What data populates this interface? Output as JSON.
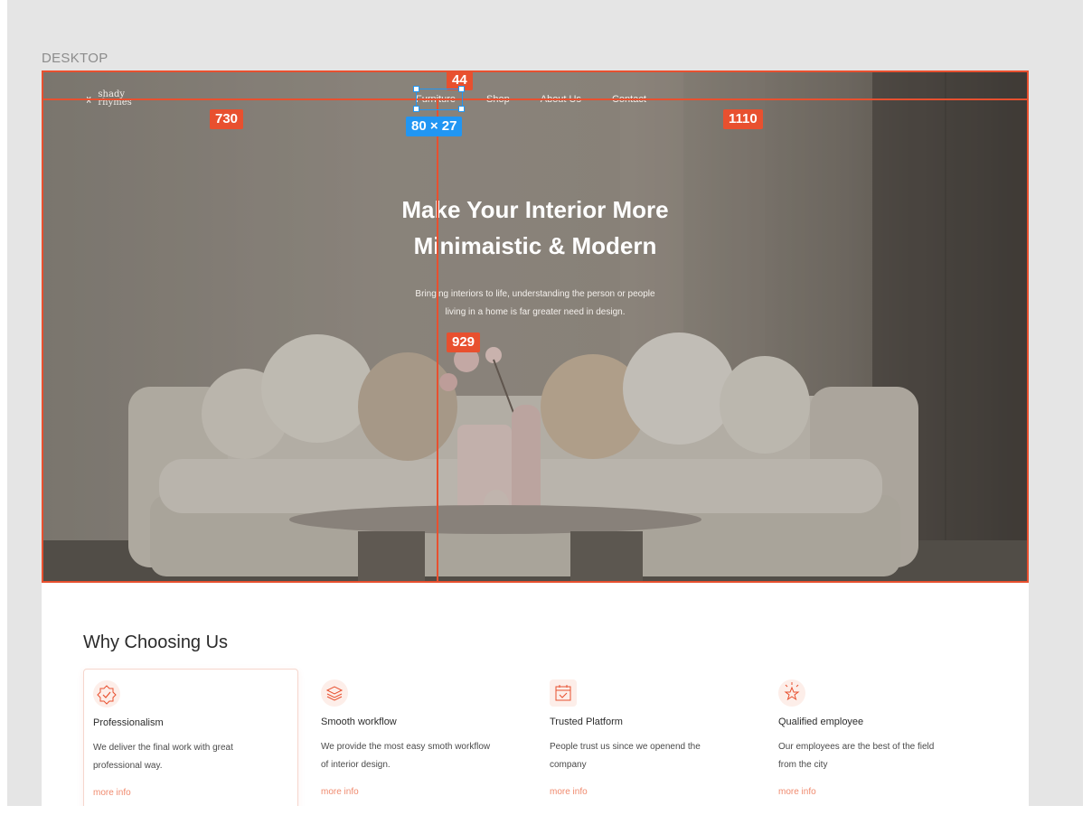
{
  "frame": {
    "label": "DESKTOP"
  },
  "header": {
    "logo_mark": "⚹",
    "logo_text": "shady rhymes",
    "nav": [
      "Furniture",
      "Shop",
      "About Us",
      "Contact"
    ]
  },
  "hero": {
    "title_line1": "Make Your Interior More",
    "title_line2": "Minimaistic & Modern",
    "subtitle_line1": "Bringing interiors to life, understanding the person or people",
    "subtitle_line2": "living in a home is far greater need in design."
  },
  "overlay": {
    "measure_top": "44",
    "measure_left": "730",
    "measure_right": "1110",
    "measure_center": "929",
    "selection_size": "80 × 27"
  },
  "why": {
    "title": "Why Choosing Us",
    "cards": [
      {
        "icon": "badge-check-icon",
        "title": "Professionalism",
        "text_line1": "We deliver the final work with great",
        "text_line2": "professional way.",
        "link": "more info"
      },
      {
        "icon": "layers-icon",
        "title": "Smooth workflow",
        "text_line1": "We provide the most easy smoth workflow",
        "text_line2": "of interior design.",
        "link": "more info"
      },
      {
        "icon": "calendar-check-icon",
        "title": "Trusted Platform",
        "text_line1": "People trust us since we openend the",
        "text_line2": "company",
        "link": "more info"
      },
      {
        "icon": "star-icon",
        "title": "Qualified employee",
        "text_line1": "Our employees are the best of the field",
        "text_line2": "from the city",
        "link": "more info"
      }
    ]
  },
  "colors": {
    "accent": "#e8502f",
    "selection": "#2196f3",
    "link": "#f08a6e"
  }
}
